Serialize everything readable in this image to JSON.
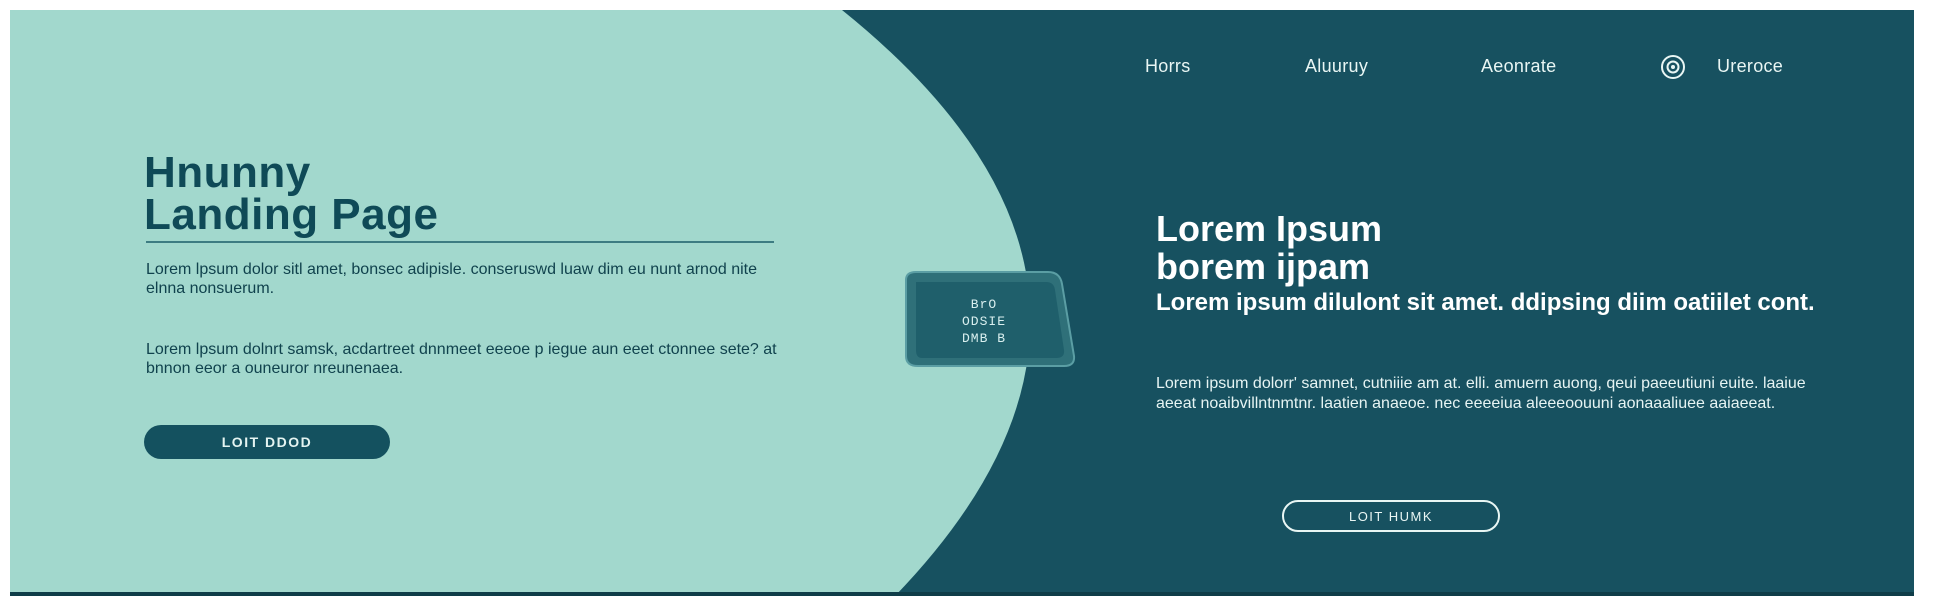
{
  "nav": {
    "items": [
      "Horrs",
      "Aluuruy",
      "Aeonrate",
      "Ureroce"
    ],
    "icon": "globe-icon"
  },
  "hero": {
    "title_line1": "Hnunny",
    "title_line2": "Landing Page",
    "paragraph1": "Lorem lpsum dolor sitl amet, bonsec adipisle. conseruswd luaw dim eu nunt arnod nite elnna nonsuerum.",
    "paragraph2": "Lorem lpsum dolnrt samsk, acdartreet dnnmeet eeeoe p iegue aun eeet ctonnee sete? at bnnon eeor a ouneuror nreunenaea.",
    "cta_label": "LOIT DDOD"
  },
  "badge": {
    "line1": "BrO",
    "line2": "ODSIE",
    "line3": "DMB B"
  },
  "main": {
    "title_line1": "Lorem Ipsum",
    "title_line2": "borem ijpam",
    "subtitle": "Lorem ipsum dilulont sit amet. ddipsing diim oatiilet cont.",
    "paragraph": "Lorem ipsum dolorr' samnet, cutniiie am at. elli. amuern auong, qeui paeeutiuni euite. laaiue aeeat noaibvillntnmtnr. laatien anaeoe. nec eeeeiua aleeeoouuni aonaaaliuee aaiaeeat.",
    "cta_label": "LOIT HUMK"
  },
  "colors": {
    "left_bg": "#a2d8cd",
    "right_bg": "#175160",
    "accent_dark": "#14515f",
    "text_light": "#e9f6f4"
  }
}
